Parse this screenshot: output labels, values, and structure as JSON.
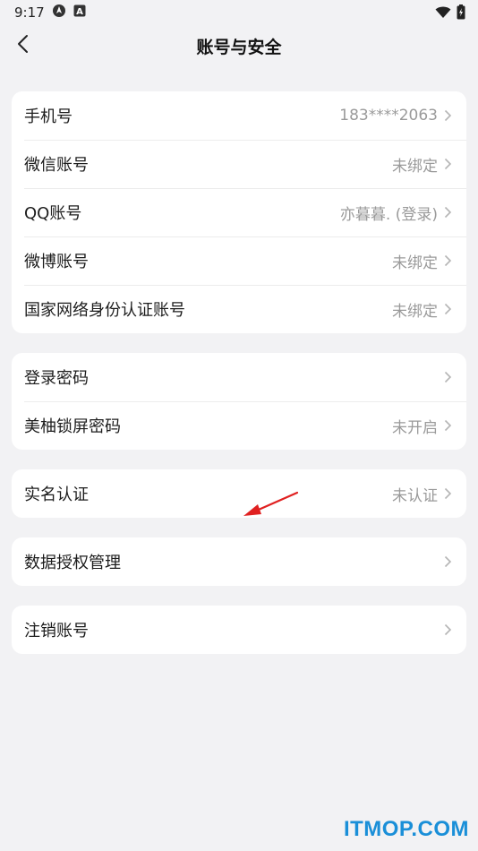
{
  "status_bar": {
    "time": "9:17",
    "icons": [
      "location-icon",
      "font-a-icon",
      "wifi-icon",
      "battery-charging-icon"
    ]
  },
  "header": {
    "title": "账号与安全",
    "back_icon": "chevron-left-icon"
  },
  "groups": [
    {
      "rows": [
        {
          "label": "手机号",
          "value": "183****2063"
        },
        {
          "label": "微信账号",
          "value": "未绑定"
        },
        {
          "label": "QQ账号",
          "value": "亦暮暮. (登录)"
        },
        {
          "label": "微博账号",
          "value": "未绑定"
        },
        {
          "label": "国家网络身份认证账号",
          "value": "未绑定"
        }
      ]
    },
    {
      "rows": [
        {
          "label": "登录密码",
          "value": ""
        },
        {
          "label": "美柚锁屏密码",
          "value": "未开启"
        }
      ]
    },
    {
      "rows": [
        {
          "label": "实名认证",
          "value": "未认证"
        }
      ]
    },
    {
      "rows": [
        {
          "label": "数据授权管理",
          "value": ""
        }
      ]
    },
    {
      "rows": [
        {
          "label": "注销账号",
          "value": ""
        }
      ]
    }
  ],
  "annotation": {
    "color": "#e02020"
  },
  "watermark": "ITMOP.COM",
  "colors": {
    "background": "#f2f2f4",
    "card": "#ffffff",
    "value_text": "#9a9a9a",
    "watermark": "#1a8fd8"
  }
}
